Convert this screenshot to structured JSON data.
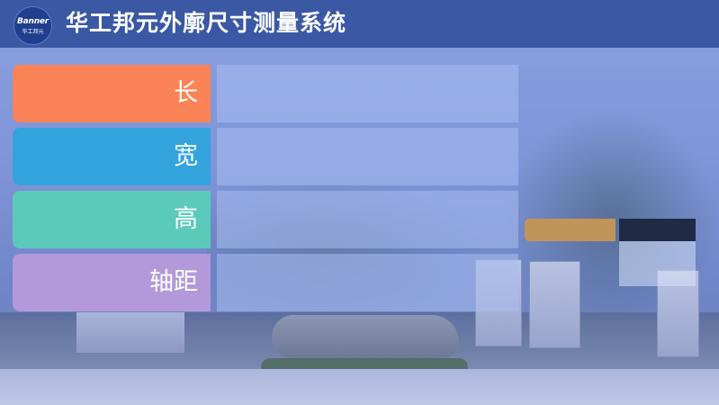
{
  "header": {
    "logo_text": "Banner",
    "logo_subtext": "华工邦元",
    "title": "华工邦元外廓尺寸测量系统"
  },
  "measurements": [
    {
      "label": "长",
      "value": "",
      "color": "#fa8358"
    },
    {
      "label": "宽",
      "value": "",
      "color": "#33a3de"
    },
    {
      "label": "高",
      "value": "",
      "color": "#5ccabb"
    },
    {
      "label": "轴距",
      "value": "",
      "color": "#b399da"
    }
  ],
  "side_panel": {
    "button_label": "",
    "status_value": "",
    "detail_value": ""
  },
  "colors": {
    "header_bg": "#3b58a4",
    "button_gold": "#c1955a",
    "field_dark": "#1f2a45"
  }
}
